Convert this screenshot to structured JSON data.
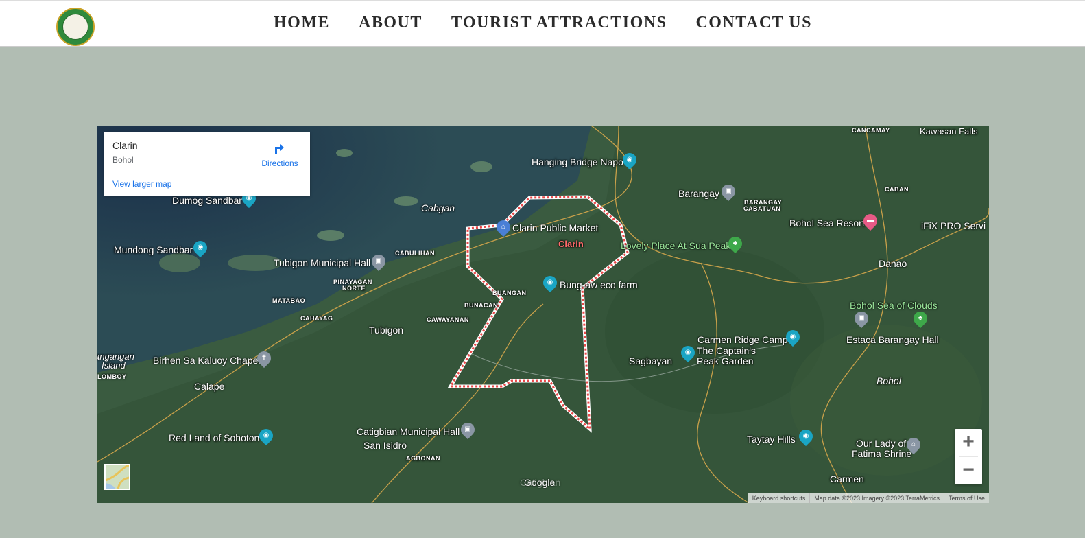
{
  "nav": {
    "items": [
      "HOME",
      "ABOUT",
      "TOURIST ATTRACTIONS",
      "CONTACT US"
    ]
  },
  "map": {
    "card": {
      "title": "Clarin",
      "subtitle": "Bohol",
      "directions": "Directions",
      "view_larger": "View larger map"
    },
    "labels": {
      "hanging_bridge": "Hanging Bridge Napo",
      "dumog": "Dumog Sandbar",
      "mundong": "Mundong Sandbar",
      "cabgan": "Cabgan",
      "market": "Clarin Public Market",
      "clarin": "Clarin",
      "lovely_place": "Lovely Place At Sua Peak",
      "tubigon_hall": "Tubigon Municipal Hall",
      "bungaw": "Bung-aw eco farm",
      "tubigon": "Tubigon",
      "birhen": "Birhen Sa Kaluoy Chapel",
      "calape": "Calape",
      "red_land": "Red Land of Sohoton",
      "catigbian": "Catigbian Municipal Hall",
      "san_isidro": "San Isidro",
      "barangay": "Barangay",
      "bohol_sea_resort": "Bohol Sea Resort",
      "ifix": "iFiX PRO Servi",
      "danao": "Danao",
      "sea_of_clouds": "Bohol Sea of Clouds",
      "estaca": "Estaca Barangay Hall",
      "carmen_ridge": "Carmen Ridge Camp",
      "captains": "The Captain's",
      "captains2": "Peak Garden",
      "sagbayan": "Sagbayan",
      "bohol": "Bohol",
      "taytay": "Taytay Hills",
      "our_lady": "Our Lady of",
      "our_lady2": "Fatima Shrine",
      "carmen": "Carmen",
      "kawasan": "Kawasan Falls",
      "angangan": "angangan",
      "island": "Island",
      "catigbian_bottom": "Catigbian",
      "sm": {
        "cancamay": "CANCAMAY",
        "caban": "CABAN",
        "batuan": "BARANGAY",
        "batuan2": "CABATUAN",
        "cabulihan": "CABULIHAN",
        "pinayagan": "PINAYAGAN",
        "norte": "NORTE",
        "matabao": "MATABAO",
        "cahayag": "CAHAYAG",
        "buangan": "BUANGAN",
        "bunacan": "BUNACAN",
        "cawayanan": "CAWAYANAN",
        "lomboy": "LOMBOY",
        "agbonan": "AGBONAN"
      }
    },
    "google": "Google",
    "attribution": [
      "Keyboard shortcuts",
      "Map data ©2023 Imagery ©2023 TerraMetrics",
      "Terms of Use"
    ],
    "zoom_in": "+",
    "zoom_out": "−",
    "icons": {
      "camera": "camera-icon",
      "government": "government-icon",
      "tree": "tree-icon",
      "shop": "shop-icon",
      "hotel": "hotel-icon",
      "church": "church-icon"
    },
    "colors": {
      "boundary": "#e84848",
      "water": "#1e3a55",
      "land": "#35553a"
    }
  }
}
